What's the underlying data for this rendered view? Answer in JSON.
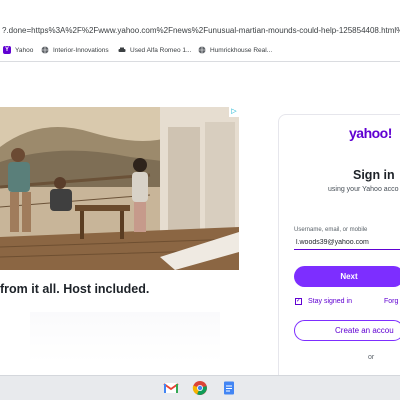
{
  "browser": {
    "url": "?.done=https%3A%2F%2Fwww.yahoo.com%2Fnews%2Funusual-martian-mounds-could-help-125854408.html%3Ffrom_au"
  },
  "bookmarks": [
    {
      "label": "Yahoo",
      "icon": "yahoo-bookmark-icon"
    },
    {
      "label": "Interior-Innovations",
      "icon": "globe-icon"
    },
    {
      "label": "Used Alfa Romeo 1...",
      "icon": "car-icon"
    },
    {
      "label": "Humrickhouse Real...",
      "icon": "globe-icon"
    }
  ],
  "ad": {
    "headline": "from it all. Host included.",
    "choices_label": "▷"
  },
  "login": {
    "logo": "yahoo!",
    "title": "Sign in",
    "subtitle": "using your Yahoo acco",
    "field_label": "Username, email, or mobile",
    "field_value": "l.woods39@yahoo.com",
    "next_label": "Next",
    "stay_signed_in": "Stay signed in",
    "stay_checked": true,
    "forgot_label": "Forg",
    "create_label": "Create an accou",
    "or_label": "or"
  },
  "taskbar": {
    "apps": [
      "gmail-icon",
      "chrome-icon",
      "docs-icon"
    ]
  },
  "colors": {
    "yahoo_purple": "#6001d2",
    "button_purple": "#7d2eff"
  }
}
